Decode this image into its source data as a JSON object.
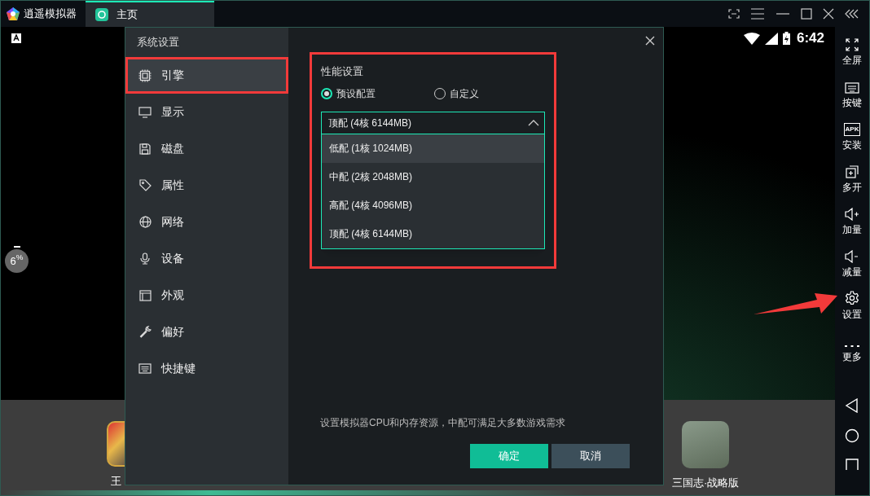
{
  "app": {
    "title": "逍遥模拟器",
    "tabs": [
      {
        "label": "主页",
        "selected": true
      }
    ]
  },
  "android": {
    "clock": "6:42",
    "cpu_badge": "6$^{%}$",
    "dock_apps": [
      {
        "label": "王"
      },
      {
        "label": "三国志·战略版"
      }
    ]
  },
  "toolbar": [
    {
      "label": "全屏",
      "kind": "fullscreen"
    },
    {
      "label": "按键",
      "kind": "keyboard"
    },
    {
      "label": "安装",
      "kind": "apk",
      "icon_text": "APK"
    },
    {
      "label": "多开",
      "kind": "multi"
    },
    {
      "label": "加量",
      "kind": "volume-up"
    },
    {
      "label": "减量",
      "kind": "volume-down"
    },
    {
      "label": "设置",
      "kind": "settings"
    },
    {
      "label": "更多",
      "kind": "more"
    }
  ],
  "dialog": {
    "title": "系统设置",
    "menu": [
      {
        "label": "引擎",
        "kind": "chip",
        "selected": true
      },
      {
        "label": "显示",
        "kind": "monitor",
        "selected": false
      },
      {
        "label": "磁盘",
        "kind": "disk",
        "selected": false
      },
      {
        "label": "属性",
        "kind": "tag",
        "selected": false
      },
      {
        "label": "网络",
        "kind": "globe",
        "selected": false
      },
      {
        "label": "设备",
        "kind": "mic",
        "selected": false
      },
      {
        "label": "外观",
        "kind": "window",
        "selected": false
      },
      {
        "label": "偏好",
        "kind": "wrench",
        "selected": false
      },
      {
        "label": "快捷键",
        "kind": "keyboard",
        "selected": false
      }
    ],
    "section_title": "性能设置",
    "modes": [
      {
        "label": "预设配置",
        "selected": true
      },
      {
        "label": "自定义",
        "selected": false
      }
    ],
    "dropdown": {
      "value": "顶配 (4核 6144MB)",
      "expanded": true,
      "options": [
        {
          "label": "低配 (1核 1024MB)",
          "hovered": true
        },
        {
          "label": "中配 (2核 2048MB)",
          "hovered": false
        },
        {
          "label": "高配 (4核 4096MB)",
          "hovered": false
        },
        {
          "label": "顶配 (4核 6144MB)",
          "hovered": false
        }
      ]
    },
    "hint": "设置模拟器CPU和内存资源，中配可满足大多数游戏需求",
    "buttons": [
      {
        "label": "确定",
        "kind": "primary"
      },
      {
        "label": "取消",
        "kind": "secondary"
      }
    ]
  }
}
